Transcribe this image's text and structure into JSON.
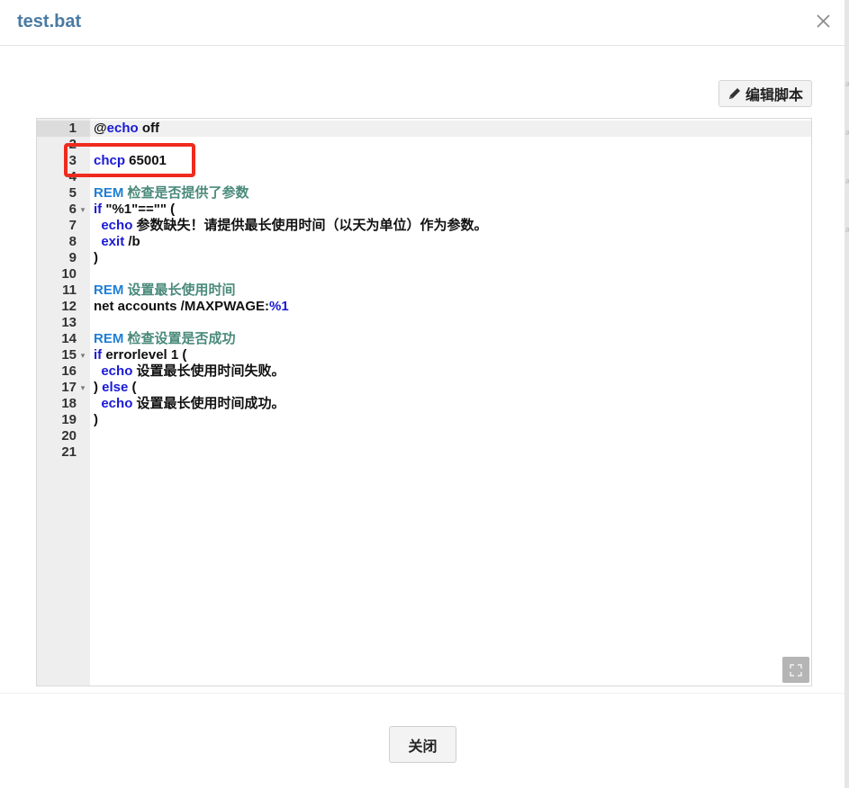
{
  "dialog": {
    "title": "test.bat",
    "edit_button_label": "编辑脚本",
    "close_button_label": "关闭"
  },
  "editor": {
    "lines": [
      {
        "num": "1",
        "fold": false,
        "parts": [
          {
            "t": "@",
            "c": "plain"
          },
          {
            "t": "echo",
            "c": "kw"
          },
          {
            "t": " off",
            "c": "plain"
          }
        ]
      },
      {
        "num": "2",
        "fold": false,
        "parts": []
      },
      {
        "num": "3",
        "fold": false,
        "parts": [
          {
            "t": "chcp",
            "c": "kw"
          },
          {
            "t": " 65001",
            "c": "plain"
          }
        ]
      },
      {
        "num": "4",
        "fold": false,
        "parts": []
      },
      {
        "num": "5",
        "fold": false,
        "parts": [
          {
            "t": "REM",
            "c": "rem"
          },
          {
            "t": " 检查是否提供了参数",
            "c": "cmt"
          }
        ]
      },
      {
        "num": "6",
        "fold": true,
        "parts": [
          {
            "t": "if",
            "c": "kw"
          },
          {
            "t": " \"%1\"==\"\" (",
            "c": "plain"
          }
        ]
      },
      {
        "num": "7",
        "fold": false,
        "parts": [
          {
            "t": "  ",
            "c": "plain"
          },
          {
            "t": "echo",
            "c": "kw"
          },
          {
            "t": " 参数缺失！请提供最长使用时间（以天为单位）作为参数。",
            "c": "plain"
          }
        ]
      },
      {
        "num": "8",
        "fold": false,
        "parts": [
          {
            "t": "  ",
            "c": "plain"
          },
          {
            "t": "exit",
            "c": "kw"
          },
          {
            "t": " /b",
            "c": "plain"
          }
        ]
      },
      {
        "num": "9",
        "fold": false,
        "parts": [
          {
            "t": ")",
            "c": "plain"
          }
        ]
      },
      {
        "num": "10",
        "fold": false,
        "parts": []
      },
      {
        "num": "11",
        "fold": false,
        "parts": [
          {
            "t": "REM",
            "c": "rem"
          },
          {
            "t": " 设置最长使用时间",
            "c": "cmt"
          }
        ]
      },
      {
        "num": "12",
        "fold": false,
        "parts": [
          {
            "t": "net accounts /MAXPWAGE:",
            "c": "plain"
          },
          {
            "t": "%1",
            "c": "kw"
          }
        ]
      },
      {
        "num": "13",
        "fold": false,
        "parts": []
      },
      {
        "num": "14",
        "fold": false,
        "parts": [
          {
            "t": "REM",
            "c": "rem"
          },
          {
            "t": " 检查设置是否成功",
            "c": "cmt"
          }
        ]
      },
      {
        "num": "15",
        "fold": true,
        "parts": [
          {
            "t": "if",
            "c": "kw"
          },
          {
            "t": " errorlevel 1 (",
            "c": "plain"
          }
        ]
      },
      {
        "num": "16",
        "fold": false,
        "parts": [
          {
            "t": "  ",
            "c": "plain"
          },
          {
            "t": "echo",
            "c": "kw"
          },
          {
            "t": " 设置最长使用时间失败。",
            "c": "plain"
          }
        ]
      },
      {
        "num": "17",
        "fold": true,
        "parts": [
          {
            "t": ") ",
            "c": "plain"
          },
          {
            "t": "else",
            "c": "kw"
          },
          {
            "t": " (",
            "c": "plain"
          }
        ]
      },
      {
        "num": "18",
        "fold": false,
        "parts": [
          {
            "t": "  ",
            "c": "plain"
          },
          {
            "t": "echo",
            "c": "kw"
          },
          {
            "t": " 设置最长使用时间成功。",
            "c": "plain"
          }
        ]
      },
      {
        "num": "19",
        "fold": false,
        "parts": [
          {
            "t": ")",
            "c": "plain"
          }
        ]
      },
      {
        "num": "20",
        "fold": false,
        "parts": []
      },
      {
        "num": "21",
        "fold": false,
        "parts": []
      }
    ]
  },
  "colors": {
    "title": "#4a7aa3",
    "keyword": "#1a1ad6",
    "rem": "#1f7fd6",
    "comment": "#4a8a7a",
    "highlight_border": "#ef2b1e"
  },
  "icons": {
    "close": "close-icon",
    "edit": "pencil-icon",
    "fold": "fold-arrow-icon",
    "fullscreen": "expand-icon"
  }
}
